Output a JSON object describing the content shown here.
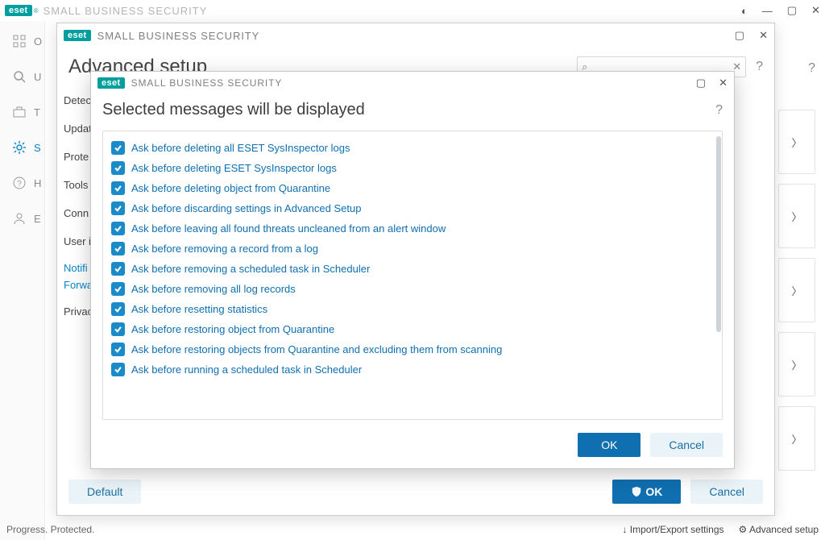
{
  "bg_window": {
    "brand": "eset",
    "title": "SMALL BUSINESS SECURITY",
    "sidebar_items": [
      "O",
      "U",
      "T",
      "S",
      "H",
      "E"
    ],
    "status_left": "Progress. Protected.",
    "status_right_import": "Import/Export settings",
    "status_right_adv": "Advanced setup"
  },
  "adv_window": {
    "brand": "eset",
    "title": "SMALL BUSINESS SECURITY",
    "heading": "Advanced setup",
    "search_placeholder": "",
    "nav": {
      "items": [
        "Detec",
        "Updat",
        "Prote",
        "Tools",
        "Conn",
        "User i"
      ],
      "sub_items": [
        "Notifi",
        "Forwa"
      ],
      "last": "Privac"
    },
    "footer": {
      "default": "Default",
      "ok": "OK",
      "cancel": "Cancel"
    }
  },
  "dialog": {
    "brand": "eset",
    "title": "SMALL BUSINESS SECURITY",
    "heading": "Selected messages will be displayed",
    "items": [
      {
        "checked": true,
        "label": "Ask before deleting all ESET SysInspector logs"
      },
      {
        "checked": true,
        "label": "Ask before deleting ESET SysInspector logs"
      },
      {
        "checked": true,
        "label": "Ask before deleting object from Quarantine"
      },
      {
        "checked": true,
        "label": "Ask before discarding settings in Advanced Setup"
      },
      {
        "checked": true,
        "label": "Ask before leaving all found threats uncleaned from an alert window"
      },
      {
        "checked": true,
        "label": "Ask before removing a record from a log"
      },
      {
        "checked": true,
        "label": "Ask before removing a scheduled task in Scheduler"
      },
      {
        "checked": true,
        "label": "Ask before removing all log records"
      },
      {
        "checked": true,
        "label": "Ask before resetting statistics"
      },
      {
        "checked": true,
        "label": "Ask before restoring object from Quarantine"
      },
      {
        "checked": true,
        "label": "Ask before restoring objects from Quarantine and excluding them from scanning"
      },
      {
        "checked": true,
        "label": "Ask before running a scheduled task in Scheduler"
      }
    ],
    "footer": {
      "ok": "OK",
      "cancel": "Cancel"
    }
  }
}
